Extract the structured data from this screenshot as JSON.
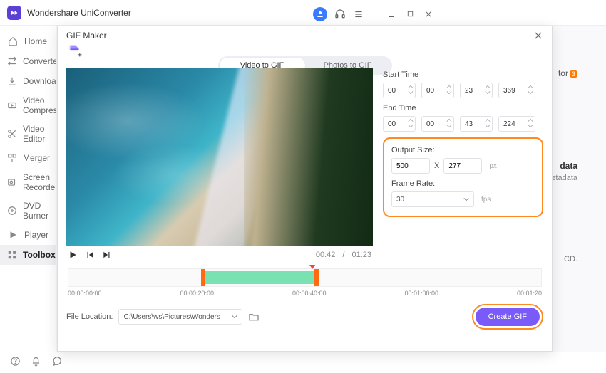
{
  "app": {
    "title": "Wondershare UniConverter"
  },
  "sidebar": {
    "items": [
      {
        "label": "Home",
        "icon": "home-icon"
      },
      {
        "label": "Converter",
        "icon": "convert-icon"
      },
      {
        "label": "Downloader",
        "icon": "download-icon"
      },
      {
        "label": "Video Compressor",
        "icon": "compress-icon"
      },
      {
        "label": "Video Editor",
        "icon": "scissors-icon"
      },
      {
        "label": "Merger",
        "icon": "merge-icon"
      },
      {
        "label": "Screen Recorder",
        "icon": "record-icon"
      },
      {
        "label": "DVD Burner",
        "icon": "disc-icon"
      },
      {
        "label": "Player",
        "icon": "play-icon"
      },
      {
        "label": "Toolbox",
        "icon": "grid-icon"
      }
    ],
    "active": 9
  },
  "background": {
    "tor_badge": "tor",
    "badge_count": "3",
    "data": "data",
    "etadata": "etadata",
    "cd": "CD."
  },
  "modal": {
    "title": "GIF Maker",
    "tabs": {
      "video": "Video to GIF",
      "photos": "Photos to GIF"
    },
    "start_label": "Start Time",
    "end_label": "End Time",
    "start": {
      "h": "00",
      "m": "00",
      "s": "23",
      "ms": "369"
    },
    "end": {
      "h": "00",
      "m": "00",
      "s": "43",
      "ms": "224"
    },
    "output_size_label": "Output Size:",
    "output_w": "500",
    "x": "X",
    "output_h": "277",
    "px": "px",
    "frame_rate_label": "Frame Rate:",
    "frame_rate": "30",
    "fps": "fps",
    "time_current": "00:42",
    "time_sep": "/",
    "time_total": "01:23",
    "ticks": [
      "00:00:00:00",
      "00:00:20:00",
      "00:00:40:00",
      "00:01:00:00",
      "00:01:20"
    ],
    "file_location_label": "File Location:",
    "file_location": "C:\\Users\\ws\\Pictures\\Wonders",
    "create": "Create GIF"
  }
}
